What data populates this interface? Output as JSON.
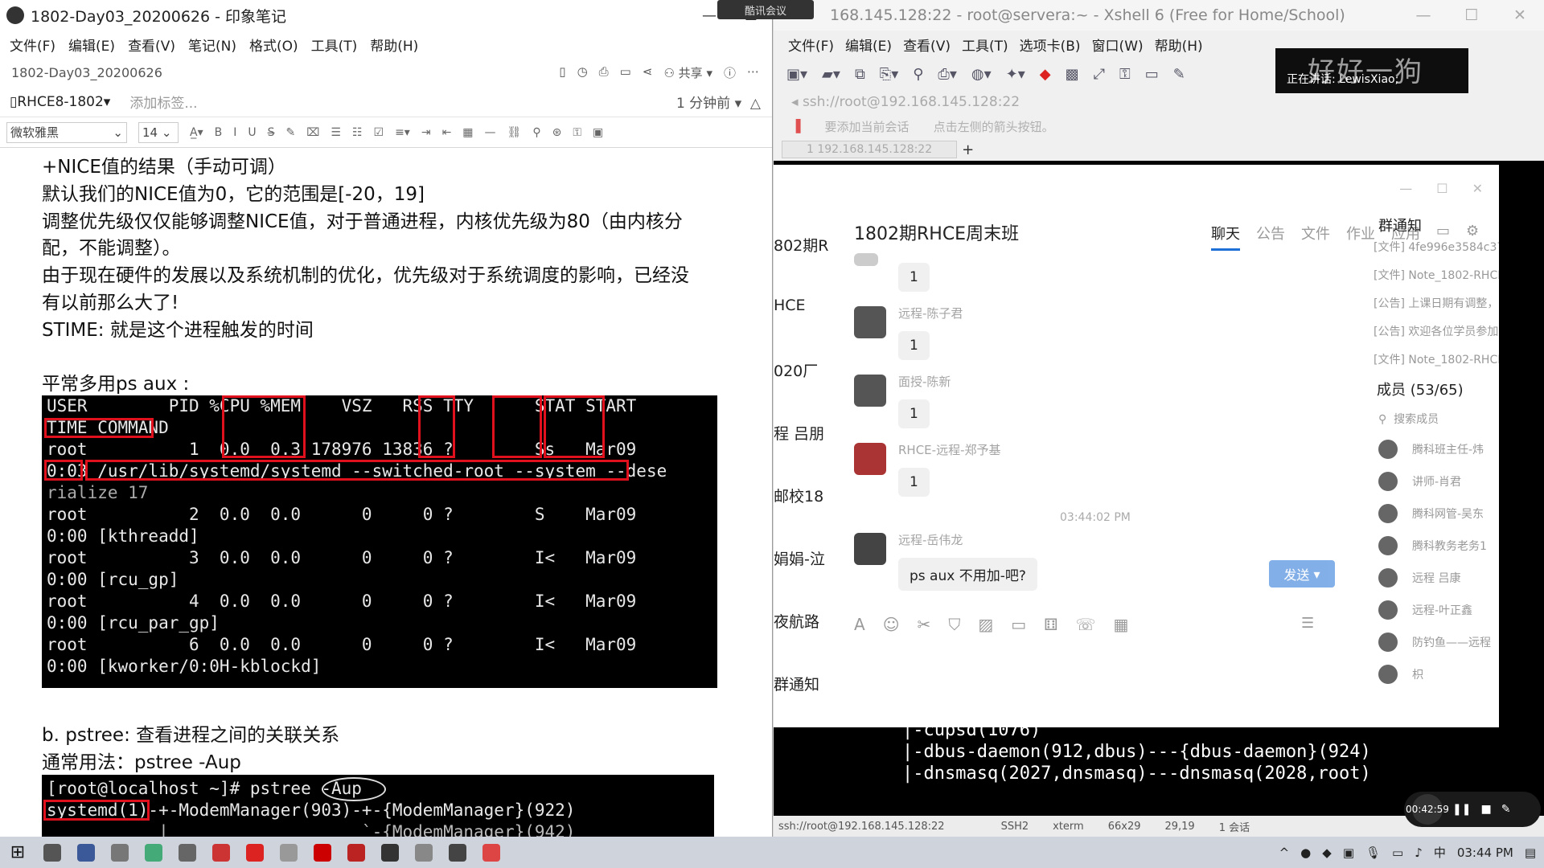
{
  "evernote": {
    "title": "1802-Day03_20200626 - 印象笔记",
    "menu": [
      "文件(F)",
      "编辑(E)",
      "查看(V)",
      "笔记(N)",
      "格式(O)",
      "工具(T)",
      "帮助(H)"
    ],
    "note_name": "1802-Day03_20200626",
    "share": "共享",
    "notebook": "RHCE8-1802",
    "add_tag": "添加标签...",
    "edited": "1 分钟前",
    "font": "微软雅黑",
    "font_size": "14",
    "lines": [
      "+NICE值的结果（手动可调）",
      "默认我们的NICE值为0，它的范围是[-20，19]",
      "调整优先级仅仅能够调整NICE值，对于普通进程，内核优先级为80（由内核分",
      "配，不能调整）。",
      "由于现在硬件的发展以及系统机制的优化，优先级对于系统调度的影响，已经没",
      "有以前那么大了!",
      "STIME: 就是这个进程触发的时间",
      "平常多用ps aux :",
      "b. pstree: 查看进程之间的关联关系",
      "通常用法：pstree -Aup"
    ],
    "term1": [
      "USER        PID %CPU %MEM    VSZ   RSS TTY      STAT START",
      "TIME COMMAND",
      "root          1  0.0  0.3 178976 13836 ?        Ss   Mar09",
      "0:03 /usr/lib/systemd/systemd --switched-root --system --dese",
      "rialize 17",
      "root          2  0.0  0.0      0     0 ?        S    Mar09",
      "0:00 [kthreadd]",
      "root          3  0.0  0.0      0     0 ?        I<   Mar09",
      "0:00 [rcu_gp]",
      "root          4  0.0  0.0      0     0 ?        I<   Mar09",
      "0:00 [rcu_par_gp]",
      "root          6  0.0  0.0      0     0 ?        I<   Mar09",
      "0:00 [kworker/0:0H-kblockd]"
    ],
    "term2": [
      "[root@localhost ~]# pstree -Aup",
      "systemd(1)-+-ModemManager(903)-+-{ModemManager}(922)",
      "           |                   `-{ModemManager}(942)"
    ]
  },
  "xshell": {
    "title": "root@servera:~ - Xshell 6 (Free for Home/School)",
    "title_prefix": "168.145.128:22",
    "menu": [
      "文件(F)",
      "编辑(E)",
      "查看(V)",
      "工具(T)",
      "选项卡(B)",
      "窗口(W)",
      "帮助(H)"
    ],
    "address": "ssh://root@192.168.145.128:22",
    "hint1": "要添加当前会话",
    "hint2": "点击左侧的箭头按钮。",
    "tab": "1 192.168.145.128:22",
    "term_lines": [
      "|-cupsd(1076)",
      "|-dbus-daemon(912,dbus)---{dbus-daemon}(924)",
      "|-dnsmasq(2027,dnsmasq)---dnsmasq(2028,root)"
    ],
    "status": [
      "ssh://root@192.168.145.128:22",
      "SSH2",
      "xterm",
      "66x29",
      "29,19",
      "1 会话"
    ]
  },
  "stream": {
    "banner": "好好一狗",
    "speaking": "正在讲话: LewisXiao;",
    "badge": "酷讯会议"
  },
  "qq": {
    "group": "1802期RHCE周末班",
    "tabs": [
      "聊天",
      "公告",
      "文件",
      "作业",
      "应用"
    ],
    "sidebar": [
      "802期R",
      "HCE",
      "020厂",
      "程 吕朋",
      "邮校18",
      "娟娟-泣",
      "夜航路",
      "群通知"
    ],
    "messages": [
      {
        "sender": "",
        "text": "1"
      },
      {
        "sender": "远程-陈子君",
        "text": "1"
      },
      {
        "sender": "面授-陈新",
        "text": "1"
      },
      {
        "sender": "RHCE-远程-郑予基",
        "text": "1"
      },
      {
        "sender": "远程-岳伟龙",
        "text": "ps aux 不用加-吧?"
      }
    ],
    "time": "03:44:02 PM",
    "send": "发送",
    "notice_title": "群通知",
    "notices": [
      "[文件] 4fe996e3584c375",
      "[文件] Note_1802-RHCE",
      "[公告] 上课日期有调整，",
      "[公告] 欢迎各位学员参加",
      "[文件] Note_1802-RHCE"
    ],
    "members_title": "成员 (53/65)",
    "search_members": "搜索成员",
    "members": [
      "腾科班主任-炜",
      "讲师-肖君",
      "腾科网管-吴东",
      "腾科教务老务1",
      "远程 吕康",
      "远程-叶正鑫",
      "防钓鱼——远程",
      "枳"
    ]
  },
  "taskbar": {
    "time": "03:44 PM",
    "record_time": "00:42:59"
  }
}
